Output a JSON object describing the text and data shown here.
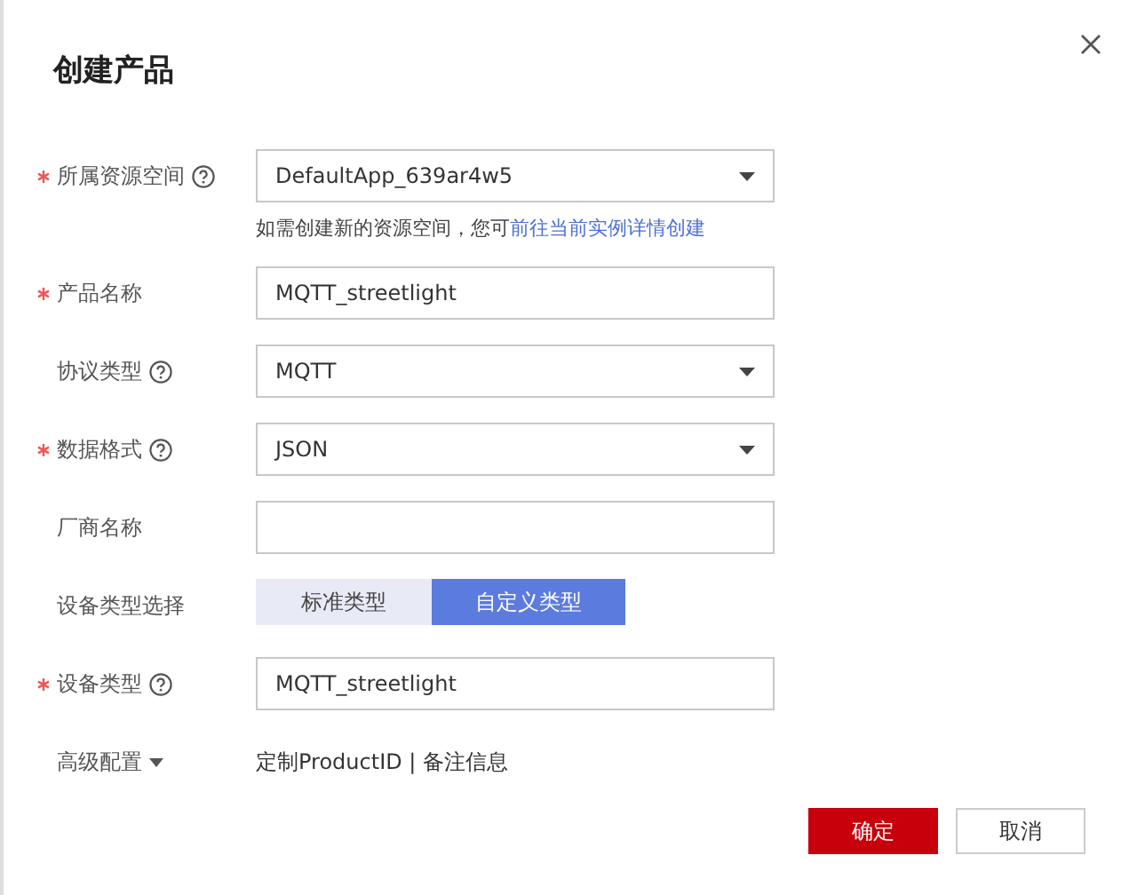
{
  "dialog": {
    "title": "创建产品"
  },
  "fields": [
    {
      "kind": "select",
      "label": "所属资源空间",
      "required": true,
      "help": true,
      "value": "DefaultApp_639ar4w5",
      "hint": "如需创建新的资源空间，您可",
      "hint_link": "前往当前实例详情创建"
    },
    {
      "kind": "input",
      "label": "产品名称",
      "required": true,
      "help": false,
      "value": "MQTT_streetlight"
    },
    {
      "kind": "select",
      "label": "协议类型",
      "required": false,
      "help": true,
      "value": "MQTT"
    },
    {
      "kind": "select",
      "label": "数据格式",
      "required": true,
      "help": true,
      "value": "JSON"
    },
    {
      "kind": "input",
      "label": "厂商名称",
      "required": false,
      "help": false
    },
    {
      "kind": "segmented",
      "label": "设备类型选择",
      "required": false,
      "help": false,
      "options": [
        {
          "label": "标准类型",
          "selected": false
        },
        {
          "label": "自定义类型",
          "selected": true
        }
      ]
    },
    {
      "kind": "input",
      "label": "设备类型",
      "required": true,
      "help": true,
      "value": "MQTT_streetlight"
    },
    {
      "kind": "advanced",
      "label": "高级配置",
      "required": false,
      "help": false,
      "value": "定制ProductID | 备注信息"
    }
  ],
  "buttons": [
    {
      "label": "确定",
      "primary": true
    },
    {
      "label": "取消",
      "primary": false
    }
  ]
}
